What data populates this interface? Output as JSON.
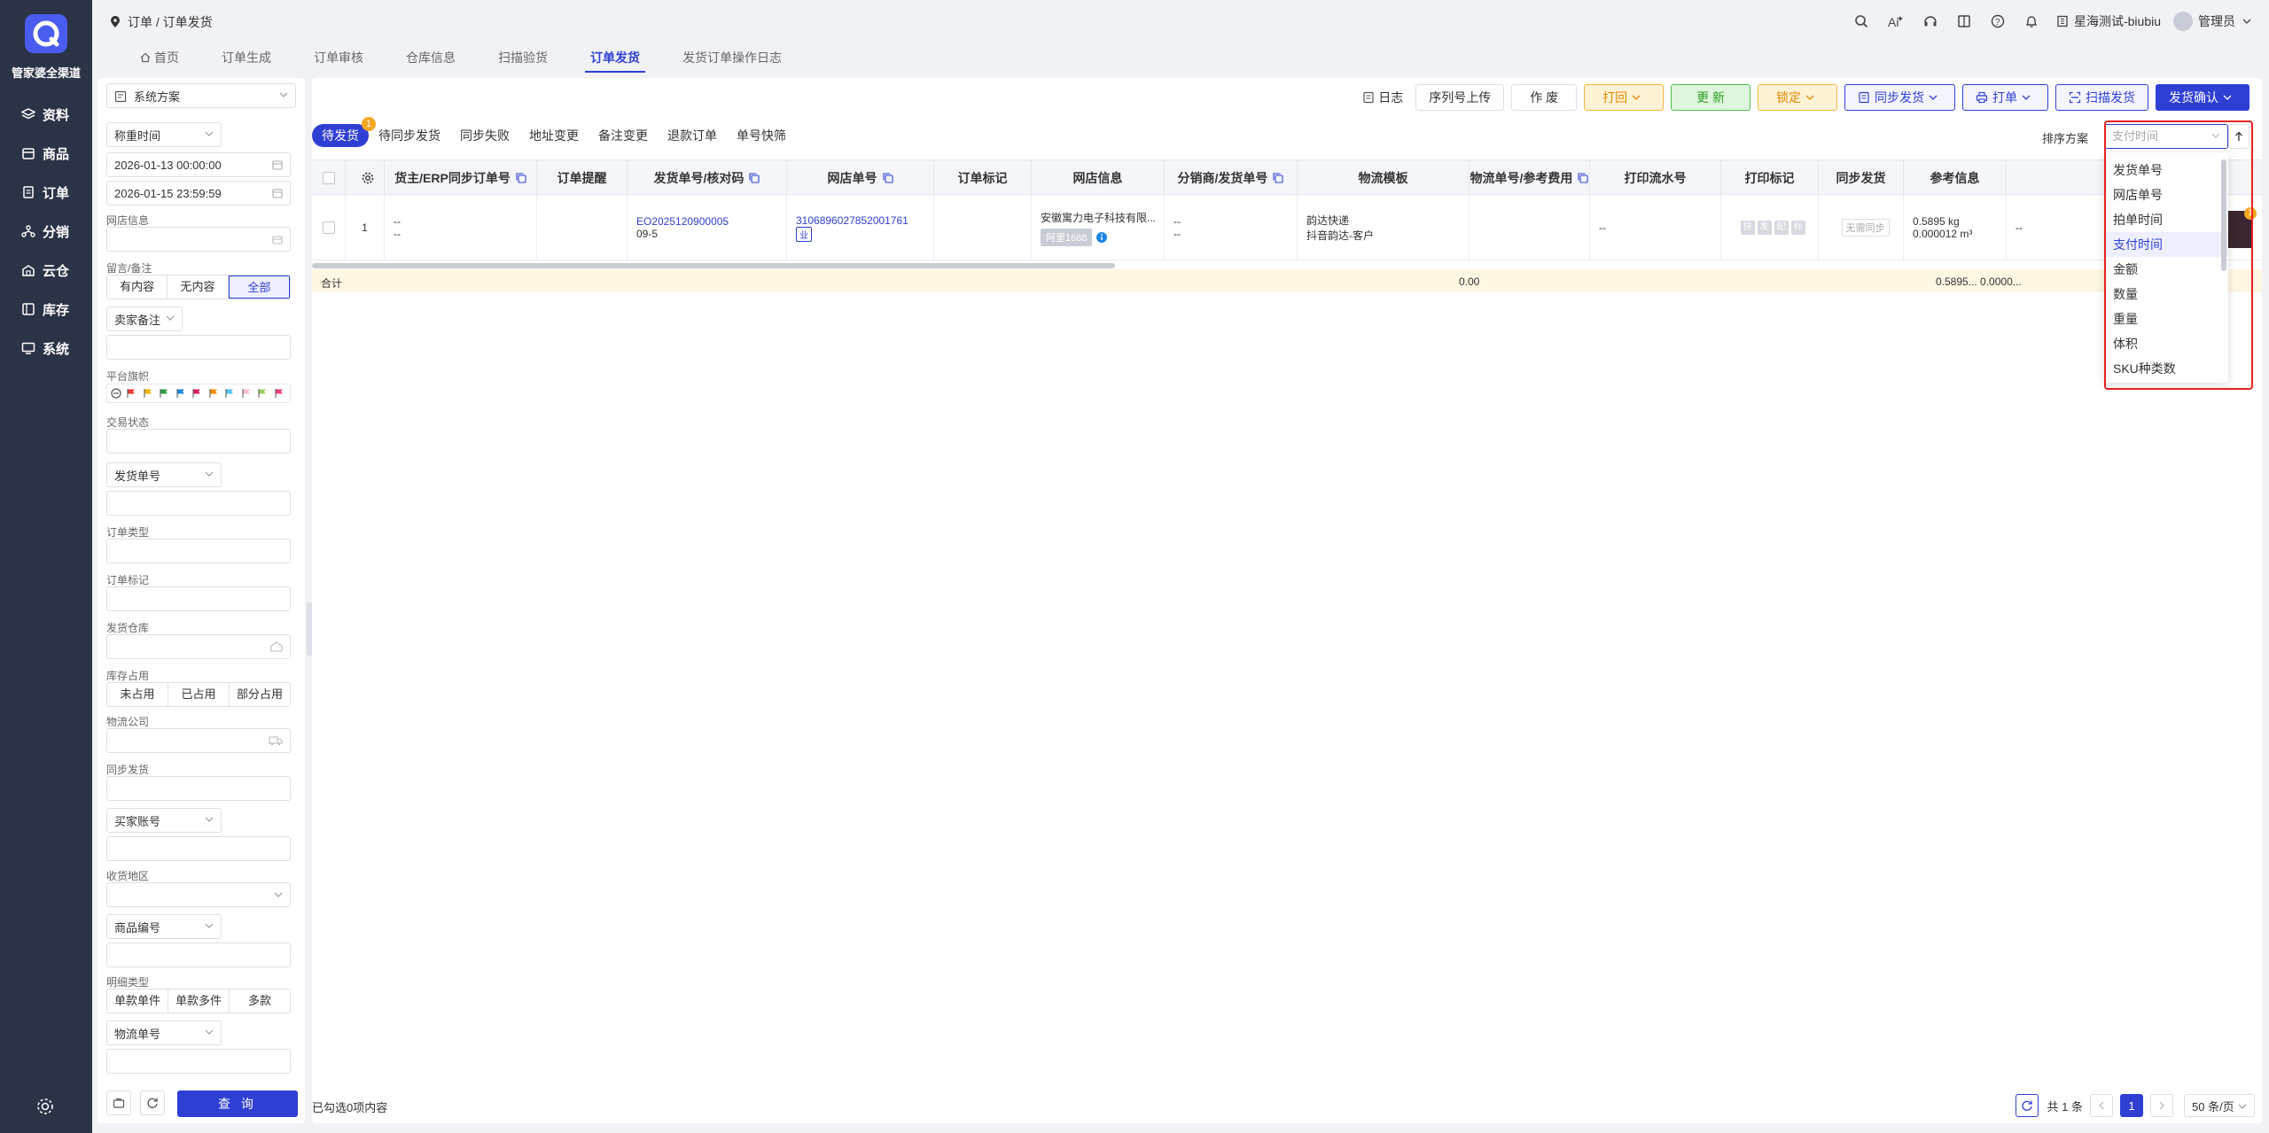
{
  "nav": {
    "brand": "管家婆全渠道",
    "items": [
      {
        "label": "资料",
        "icon": "layers-icon"
      },
      {
        "label": "商品",
        "icon": "box-icon"
      },
      {
        "label": "订单",
        "icon": "order-icon"
      },
      {
        "label": "分销",
        "icon": "distribution-icon"
      },
      {
        "label": "云仓",
        "icon": "cloud-warehouse-icon"
      },
      {
        "label": "库存",
        "icon": "inventory-icon"
      },
      {
        "label": "系统",
        "icon": "monitor-icon"
      }
    ]
  },
  "header": {
    "breadcrumb": "订单 / 订单发货",
    "company": "星海测试-biubiu",
    "user": "管理员"
  },
  "page_tabs": [
    "首页",
    "订单生成",
    "订单审核",
    "仓库信息",
    "扫描验货",
    "订单发货",
    "发货订单操作日志"
  ],
  "page_tabs_active": 5,
  "filter": {
    "scheme": "系统方案",
    "time_type": "称重时间",
    "date_from": "2026-01-13 00:00:00",
    "date_to": "2026-01-15 23:59:59",
    "shop_label": "网店信息",
    "remark_label": "留言/备注",
    "remark_options": [
      "有内容",
      "无内容",
      "全部"
    ],
    "remark_selected": 2,
    "seller_remark": "卖家备注",
    "flag_label": "平台旗帜",
    "flag_colors": [
      "#e53935",
      "#f5b300",
      "#2e9e3e",
      "#1e88e5",
      "#d81b60",
      "#fb8c00",
      "#4fc3f7",
      "#f8bbd0",
      "#9ccc65",
      "#ec407a"
    ],
    "trade_status_label": "交易状态",
    "ship_no_select": "发货单号",
    "order_type_label": "订单类型",
    "order_mark_label": "订单标记",
    "warehouse_label": "发货仓库",
    "stock_label": "库存占用",
    "stock_options": [
      "未占用",
      "已占用",
      "部分占用"
    ],
    "logistics_label": "物流公司",
    "sync_label": "同步发货",
    "buyer_select": "买家账号",
    "region_label": "收货地区",
    "product_select": "商品编号",
    "detail_label": "明细类型",
    "detail_options": [
      "单款单件",
      "单款多件",
      "多款"
    ],
    "logistics_no_select": "物流单号",
    "query": "查 询"
  },
  "toolbar": {
    "log": "日志",
    "serial_upload": "序列号上传",
    "void": "作 废",
    "print_back": "打回",
    "update": "更 新",
    "lock": "锁定",
    "sync_ship": "同步发货",
    "print": "打单",
    "scan_ship": "扫描发货",
    "confirm": "发货确认"
  },
  "status_tabs": [
    "待发货",
    "待同步发货",
    "同步失败",
    "地址变更",
    "备注变更",
    "退款订单",
    "单号快筛"
  ],
  "status_badge": "1",
  "sort": {
    "label": "排序方案",
    "placeholder": "支付时间",
    "options": [
      "发货单号",
      "网店单号",
      "拍单时间",
      "支付时间",
      "金额",
      "数量",
      "重量",
      "体积",
      "SKU种类数"
    ],
    "highlighted": 3
  },
  "table": {
    "columns": [
      "货主/ERP同步订单号",
      "订单提醒",
      "发货单号/核对码",
      "网店单号",
      "订单标记",
      "网店信息",
      "分销商/发货单号",
      "物流模板",
      "物流单号/参考费用",
      "打印流水号",
      "打印标记",
      "同步发货",
      "参考信息"
    ],
    "row": {
      "index": "1",
      "erp": [
        "--",
        "--"
      ],
      "ship_no": "EO2025120900005",
      "check_code": "09-5",
      "shop_order_no": "3106896027852001761",
      "shop_order_tag": "业",
      "shop_name": "安徽寓力电子科技有限...",
      "shop_platform": "阿里1688",
      "distributor": [
        "--",
        "--"
      ],
      "logistics_template": [
        "韵达快递",
        "抖音韵达-客户"
      ],
      "print_serial": "--",
      "print_marks": [
        "快",
        "发",
        "配",
        "标"
      ],
      "sync_ship": "无需同步",
      "ref_weight": "0.5895 kg",
      "ref_volume": "0.000012 m³",
      "extra": "--",
      "thumb_badge": "1"
    },
    "summary": {
      "label": "合计",
      "fee": "0.00",
      "ref": "0.5895... 0.0000..."
    }
  },
  "footer": {
    "selected": "已勾选0项内容",
    "total": "共 1 条",
    "page": "1",
    "page_size": "50 条/页"
  },
  "colors": {
    "primary": "#2f3fd4",
    "nav_bg": "#2b3347",
    "highlight_outline": "#e52222"
  }
}
